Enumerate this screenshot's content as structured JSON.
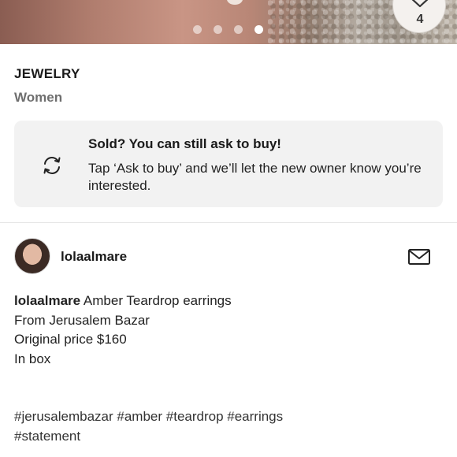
{
  "hero": {
    "image_alt": "product photo",
    "dots_count": 4,
    "active_dot": 3,
    "like_count": "4"
  },
  "details": {
    "category": "JEWELRY",
    "department": "Women"
  },
  "notice": {
    "title": "Sold? You can still ask to buy!",
    "body": "Tap ‘Ask to buy’ and we’ll let the new owner know you’re interested.",
    "icon": "refresh-icon"
  },
  "seller": {
    "username": "lolaalmare",
    "message_icon": "mail-icon"
  },
  "description": {
    "seller": "lolaalmare",
    "title": "Amber Teardrop earrings",
    "line2": "From Jerusalem Bazar",
    "line3": "Original price $160",
    "line4": "In box"
  },
  "hashtags": {
    "line1": "#jerusalembazar #amber #teardrop #earrings",
    "line2": "#statement"
  }
}
